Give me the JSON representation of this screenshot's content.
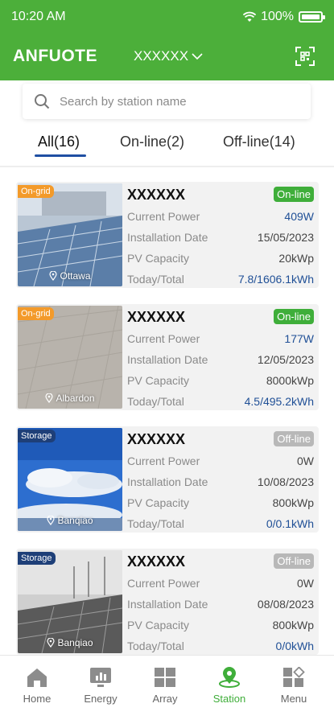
{
  "status_bar": {
    "time": "10:20 AM",
    "battery": "100%"
  },
  "header": {
    "brand": "ANFUOTE",
    "station_select": "XXXXXX"
  },
  "search": {
    "placeholder": "Search by station name"
  },
  "tabs": [
    {
      "label": "All(16)",
      "active": true
    },
    {
      "label": "On-line(2)",
      "active": false
    },
    {
      "label": "Off-line(14)",
      "active": false
    }
  ],
  "labels": {
    "current_power": "Current Power",
    "installation_date": "Installation Date",
    "pv_capacity": "PV Capacity",
    "today_total": "Today/Total"
  },
  "stations": [
    {
      "name": "XXXXXX",
      "status": "On-line",
      "type": "On-grid",
      "location": "Ottawa",
      "current_power": "409W",
      "installation_date": "15/05/2023",
      "pv_capacity": "20kWp",
      "today_total": "7.8/1606.1kWh"
    },
    {
      "name": "XXXXXX",
      "status": "On-line",
      "type": "On-grid",
      "location": "Albardon",
      "current_power": "177W",
      "installation_date": "12/05/2023",
      "pv_capacity": "8000kWp",
      "today_total": "4.5/495.2kWh"
    },
    {
      "name": "XXXXXX",
      "status": "Off-line",
      "type": "Storage",
      "location": "Banqiao",
      "current_power": "0W",
      "installation_date": "10/08/2023",
      "pv_capacity": "800kWp",
      "today_total": "0/0.1kWh"
    },
    {
      "name": "XXXXXX",
      "status": "Off-line",
      "type": "Storage",
      "location": "Banqiao",
      "current_power": "0W",
      "installation_date": "08/08/2023",
      "pv_capacity": "800kWp",
      "today_total": "0/0kWh"
    }
  ],
  "bottom_nav": [
    {
      "label": "Home",
      "icon": "home-icon",
      "active": false
    },
    {
      "label": "Energy",
      "icon": "energy-icon",
      "active": false
    },
    {
      "label": "Array",
      "icon": "array-icon",
      "active": false
    },
    {
      "label": "Station",
      "icon": "station-icon",
      "active": true
    },
    {
      "label": "Menu",
      "icon": "menu-icon",
      "active": false
    }
  ],
  "colors": {
    "brand_green": "#4caf3a",
    "online": "#3fae3a",
    "offline": "#b8b8b8",
    "tab_underline": "#1f4fa3",
    "on_grid_tag": "#f39a2a",
    "storage_tag": "#1e3f78"
  }
}
